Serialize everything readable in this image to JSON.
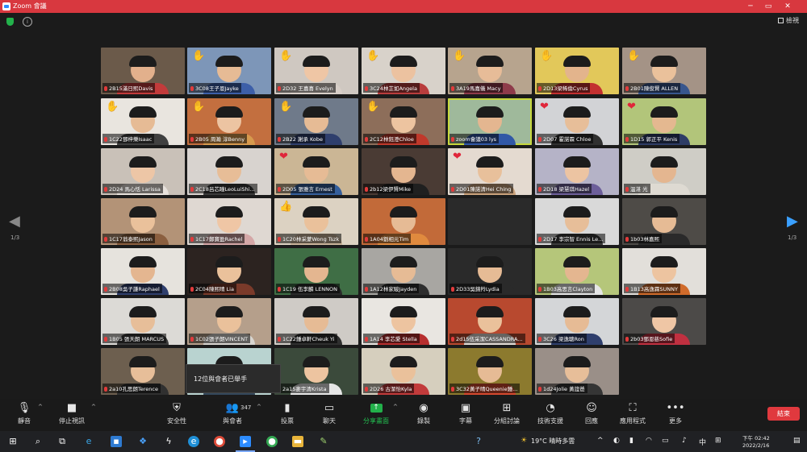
{
  "window": {
    "title": "Zoom 會議",
    "minimize": "─",
    "maximize": "▭",
    "close": "✕"
  },
  "top": {
    "view_label": "檢視"
  },
  "gallery": {
    "page_left": "1/3",
    "page_right": "1/3",
    "tiles": [
      {
        "label": "2B15滿日熙Davis",
        "bg": "#6b5a4a",
        "skin": "#e2b08c",
        "shirt": "#c23b3b",
        "reaction": ""
      },
      {
        "label": "3C08王子恩Jayke",
        "bg": "#7d96b8",
        "skin": "#e6bb95",
        "shirt": "#3d5fa8",
        "reaction": "✋"
      },
      {
        "label": "2D32 王嘉喜 Evelyn",
        "bg": "#cfc8c1",
        "skin": "#efc6a5",
        "shirt": "#d8cfc8",
        "reaction": "✋"
      },
      {
        "label": "3C24林芷如Angela",
        "bg": "#d8d2ca",
        "skin": "#ecc2a0",
        "shirt": "#b93d3d",
        "reaction": "✋"
      },
      {
        "label": "3A19馬嘉儀 Macy",
        "bg": "#b7a48e",
        "skin": "#e7bc98",
        "shirt": "#8e3b4a",
        "reaction": "✋"
      },
      {
        "label": "2D13梁稀倫Cyrus",
        "bg": "#e2c85a",
        "skin": "#e3b48c",
        "shirt": "#c33030",
        "reaction": "✋"
      },
      {
        "label": "2B01陳俊賢 ALLEN",
        "bg": "#a49386",
        "skin": "#eac19b",
        "shirt": "#38568d",
        "reaction": "✋"
      },
      {
        "label": "1C22鄧梓樂Isaac",
        "bg": "#e9e5df",
        "skin": "#e6bb95",
        "shirt": "#404040",
        "reaction": "✋"
      },
      {
        "label": "2B05 周瀚 淳Benny",
        "bg": "#c36f3f",
        "skin": "#ecc4a2",
        "shirt": "#d79a4e",
        "reaction": "✋"
      },
      {
        "label": "2B22 謝承 Kobe",
        "bg": "#6f7a8a",
        "skin": "#e6bb95",
        "shirt": "#2f3f6d",
        "reaction": "✋"
      },
      {
        "label": "2C12林鈺澄Chloe",
        "bg": "#8d6e5a",
        "skin": "#edc4a0",
        "shirt": "#c0392b",
        "reaction": "✋"
      },
      {
        "label": "zoom會議03 lys",
        "bg": "#9fb99b",
        "skin": "#e4b690",
        "shirt": "#3158a6",
        "reaction": "",
        "active": true
      },
      {
        "label": "2D07 霍諾霖 Chloe",
        "bg": "#d2d3d6",
        "skin": "#e7be99",
        "shirt": "#303030",
        "reaction": "❤"
      },
      {
        "label": "1D15 郭正平 Kenis",
        "bg": "#b2c57a",
        "skin": "#e4b890",
        "shirt": "#2e3d66",
        "reaction": "❤"
      },
      {
        "label": "2D24 馬心恬 Larissa",
        "bg": "#c9c1b8",
        "skin": "#edc6a6",
        "shirt": "#e8e2dc",
        "reaction": ""
      },
      {
        "label": "2C18呂芯瞳LeoLuiShi...",
        "bg": "#d8d3cf",
        "skin": "#e7bd97",
        "shirt": "#3b3b3b",
        "reaction": ""
      },
      {
        "label": "2D05 張雅言 Ernest",
        "bg": "#cbb695",
        "skin": "#e6bb95",
        "shirt": "#355f9b",
        "reaction": "❤"
      },
      {
        "label": "2b12梁伊賢Mike",
        "bg": "#4a3b34",
        "skin": "#e4b690",
        "shirt": "#202020",
        "reaction": ""
      },
      {
        "label": "2D01陳諾清Hei Ching",
        "bg": "#e4dad0",
        "skin": "#e8c09b",
        "shirt": "#caa27c",
        "reaction": "❤"
      },
      {
        "label": "2D18 梁慧琪Hazel",
        "bg": "#b5b3c7",
        "skin": "#ecc4a2",
        "shirt": "#6d5f9a",
        "reaction": ""
      },
      {
        "label": "溫湛 光",
        "bg": "#cfcdc6",
        "skin": "#e4b690",
        "shirt": "#dedad2",
        "reaction": ""
      },
      {
        "label": "1C17翁泰熙Jason",
        "bg": "#b39377",
        "skin": "#eac19b",
        "shirt": "#8b5f3f",
        "reaction": ""
      },
      {
        "label": "1C17鄭寶盈Rachel",
        "bg": "#dfd8d2",
        "skin": "#efc6a5",
        "shirt": "#d4a7a7",
        "reaction": ""
      },
      {
        "label": "1C20林采蒙Wong Tszk",
        "bg": "#dcd2c2",
        "skin": "#eac19b",
        "shirt": "#c9b49a",
        "reaction": "👍"
      },
      {
        "label": "1A04劉相元Tim",
        "bg": "#c26a39",
        "skin": "#e6bb95",
        "shirt": "#e08a3e",
        "reaction": ""
      },
      {
        "label": "",
        "bg": "#2a2a2a",
        "skin": "#2a2a2a",
        "shirt": "#2a2a2a",
        "reaction": "",
        "empty": true
      },
      {
        "label": "2D17 李宗智 Ennis Le...",
        "bg": "#d9d9d9",
        "skin": "#e7be99",
        "shirt": "#3c3c3c",
        "reaction": ""
      },
      {
        "label": "1b03林嘉熙",
        "bg": "#4e4b47",
        "skin": "#e6bb95",
        "shirt": "#2a2a2a",
        "reaction": ""
      },
      {
        "label": "2B08吳子謙Raphael",
        "bg": "#e6e3dd",
        "skin": "#e4b690",
        "shirt": "#2f3f6d",
        "reaction": ""
      },
      {
        "label": "2C04陳熙晴 Lia",
        "bg": "#2c2320",
        "skin": "#eac19b",
        "shirt": "#7a3a2a",
        "reaction": ""
      },
      {
        "label": "1C19 伍李麟 LENNON",
        "bg": "#3f6e45",
        "skin": "#e4b690",
        "shirt": "#2a2a2a",
        "reaction": ""
      },
      {
        "label": "1A12林家駿Jayden",
        "bg": "#a8a6a2",
        "skin": "#e6bb95",
        "shirt": "#2e2e2e",
        "reaction": ""
      },
      {
        "label": "2D33吳錦羚Lydia",
        "bg": "#2a2a2a",
        "skin": "#e6bb95",
        "shirt": "#2a2a2a",
        "reaction": ""
      },
      {
        "label": "1B03高思言Clayton",
        "bg": "#b5c67a",
        "skin": "#e4b690",
        "shirt": "#e6e6e6",
        "reaction": ""
      },
      {
        "label": "1B13高逸霖SUNNY",
        "bg": "#e2dfda",
        "skin": "#edc4a0",
        "shirt": "#d06b2b",
        "reaction": ""
      },
      {
        "label": "1B05 張天朗 MARCUS",
        "bg": "#dcdad6",
        "skin": "#e7be99",
        "shirt": "#3b3b3b",
        "reaction": ""
      },
      {
        "label": "1C02張子朗VINCENT",
        "bg": "#b59f8b",
        "skin": "#eac19b",
        "shirt": "#d8d5d0",
        "reaction": ""
      },
      {
        "label": "1C22鍾卓軒Cheuk Yi",
        "bg": "#cfcbc6",
        "skin": "#e6bb95",
        "shirt": "#2f2f2f",
        "reaction": ""
      },
      {
        "label": "1A14 李芯愛 Stella",
        "bg": "#e9e6e1",
        "skin": "#edc4a0",
        "shirt": "#b72f2f",
        "reaction": ""
      },
      {
        "label": "2d15伍采潔CASSANDRA...",
        "bg": "#b8492f",
        "skin": "#eac19b",
        "shirt": "#e2dcd6",
        "reaction": ""
      },
      {
        "label": "3C26 梁逸聰Ron",
        "bg": "#d4d6d8",
        "skin": "#e6bb95",
        "shirt": "#2f3f6d",
        "reaction": ""
      },
      {
        "label": "2b03鄧恩慈Sofie",
        "bg": "#4c4a48",
        "skin": "#efc6a5",
        "shirt": "#c03040",
        "reaction": ""
      },
      {
        "label": "2a10孔思朗Terence",
        "bg": "#6d5f4f",
        "skin": "#e7be99",
        "shirt": "#303030",
        "reaction": ""
      },
      {
        "label": "",
        "bg": "#b9d3d0",
        "skin": "#e6bb95",
        "shirt": "#33475b",
        "reaction": ""
      },
      {
        "label": "2a15麥宇清Krista",
        "bg": "#3b4a3b",
        "skin": "#edc4a0",
        "shirt": "#e6e6e6",
        "reaction": ""
      },
      {
        "label": "2D26 古潔怡Kyla",
        "bg": "#d6cfbe",
        "skin": "#eac19b",
        "shirt": "#c23b3b",
        "reaction": ""
      },
      {
        "label": "3C32黃子晴Queenie鍾...",
        "bg": "#8c7a2e",
        "skin": "#e6bb95",
        "shirt": "#d64a2f",
        "reaction": ""
      },
      {
        "label": "1d24Jolie 黃誼爸",
        "bg": "#9a8f88",
        "skin": "#e7be99",
        "shirt": "#353535",
        "reaction": ""
      }
    ]
  },
  "tooltip": {
    "text": "12位與會者已舉手"
  },
  "toolbar": {
    "mute": "靜音",
    "stop_video": "停止視訊",
    "security": "安全性",
    "participants": "與會者",
    "participant_count": "347",
    "polls": "投票",
    "chat": "聊天",
    "share_screen": "分享畫面",
    "record": "錄製",
    "captions": "字幕",
    "breakout": "分組討論",
    "tech_support": "技術支援",
    "reactions": "回應",
    "apps": "應用程式",
    "more": "更多",
    "end": "結束"
  },
  "taskbar": {
    "weather": "19°C 晴時多雲",
    "ime": "中",
    "clock_time": "下午 02:42",
    "clock_date": "2022/2/16"
  },
  "colors": {
    "titlebar": "#d8383f",
    "end_button": "#e0393e",
    "share_green": "#22b04a",
    "active_outline": "#c7d83d",
    "nav_arrow": "#3aa0ff"
  }
}
